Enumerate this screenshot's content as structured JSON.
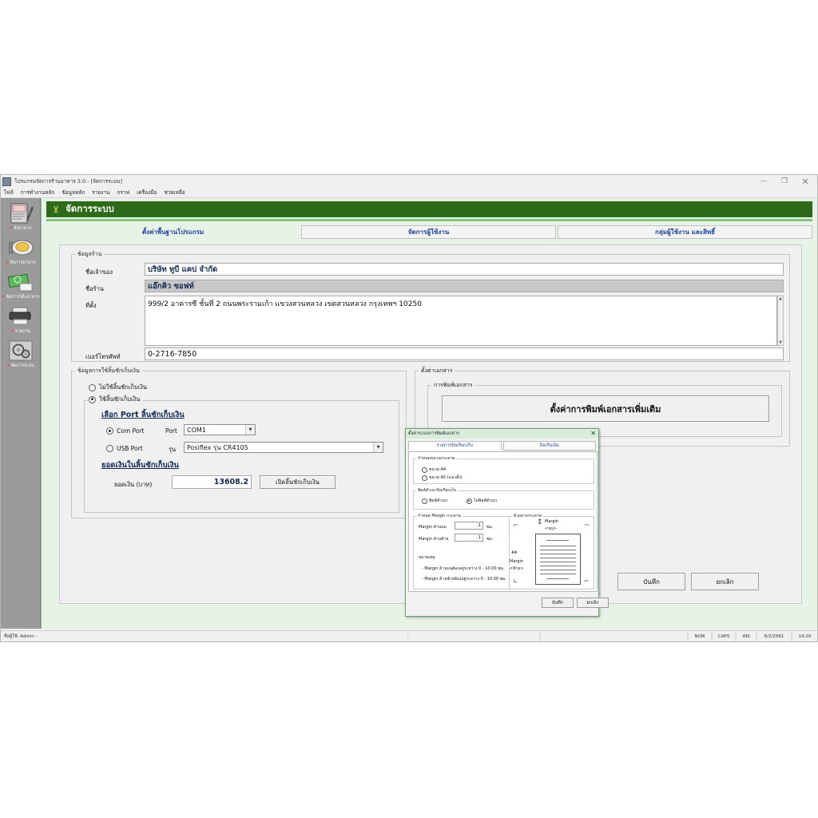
{
  "window": {
    "title": "โปรแกรมจัดการร้านอาหาร 3.0 - [จัดการระบบ]",
    "minimize": "—",
    "maximize": "❐",
    "close": "✕"
  },
  "menubar": {
    "items": [
      {
        "label": "ไฟล์"
      },
      {
        "label": "การทำงานหลัก"
      },
      {
        "label": "ข้อมูลหลัก"
      },
      {
        "label": "รายงาน"
      },
      {
        "label": "กราฟ"
      },
      {
        "label": "เครื่องมือ"
      },
      {
        "label": "ช่วยเหลือ"
      }
    ]
  },
  "sidebar": {
    "items": [
      {
        "label": "สั่งอาหาร",
        "icon": "order-notepad-icon"
      },
      {
        "label": "จัดการอาหาร",
        "icon": "food-plate-icon"
      },
      {
        "label": "จัดการโต๊ะอาหาร",
        "icon": "money-icon"
      },
      {
        "label": "รายงาน",
        "icon": "printer-icon"
      },
      {
        "label": "จัดการระบบ",
        "icon": "gears-icon"
      }
    ]
  },
  "header": {
    "icon": "funnel-icon",
    "title": "จัดการระบบ"
  },
  "tabs": [
    {
      "label": "ตั้งค่าพื้นฐานโปรแกรม",
      "active": true
    },
    {
      "label": "จัดการผู้ใช้งาน",
      "active": false
    },
    {
      "label": "กลุ่มผู้ใช้งาน และสิทธิ์",
      "active": false
    }
  ],
  "shop_info": {
    "legend": "ข้อมูลร้าน",
    "owner_label": "ชื่อเจ้าของ",
    "owner_value": "บริษัท ทูบี แคป จำกัด",
    "shop_label": "ชื่อร้าน",
    "shop_value": "แอ๊กคิว ซอฟท์",
    "address_label": "ที่ตั้ง",
    "address_value": "999/2 อาคารซี ชั้นที่ 2 ถนนพระรามเก้า แขวงสวนหลวง เขตสวนหลวง กรุงเทพฯ 10250",
    "phone_label": "เบอร์โทรศัพท์",
    "phone_value": "0-2716-7850"
  },
  "drawer": {
    "legend": "ข้อมูลการใช้ลิ้นชักเก็บเงิน",
    "opt_no": "ไม่ใช้ลิ้นชักเก็บเงิน",
    "opt_yes": "ใช้ลิ้นชักเก็บเงิน",
    "port_heading": "เลือก Port ลิ้นชักเก็บเงิน",
    "com_port_label": "Com Port",
    "port_label": "Port",
    "port_value": "COM1",
    "usb_port_label": "USB Port",
    "model_label": "รุ่น",
    "model_value": "Posiflex รุ่น CR4105",
    "amount_heading": "ยอดเงินในลิ้นชักเก็บเงิน",
    "amount_label": "ยอดเงิน (บาท)",
    "amount_value": "13608.2",
    "open_drawer_button": "เปิดลิ้นชักเก็บเงิน"
  },
  "doc_settings": {
    "legend": "ตั้งค่าเอกสาร",
    "print_legend": "การพิมพ์เอกสาร",
    "more_settings_button": "ตั้งค่าการพิมพ์เอกสารเพิ่มเติม"
  },
  "footer": {
    "save": "บันทึก",
    "cancel": "ยกเลิก"
  },
  "dialog": {
    "title": "ตั้งค่าระบบการพิมพ์เอกสาร",
    "close": "✕",
    "tabs": [
      {
        "label": "รายการบิลเรียกเก็บ",
        "active": true
      },
      {
        "label": "บิลเก็บเงิน",
        "active": false
      }
    ],
    "paper": {
      "legend": "กำหนดขนาดกระดาษ",
      "a4": "ขนาด A4",
      "a5": "ขนาด A5 (แนวตั้ง)"
    },
    "copy": {
      "legend": "พิมพ์สำเนาบิลเรียกเก็บ",
      "yes": "พิมพ์สำเนา",
      "no": "ไม่พิมพ์สำเนา"
    },
    "margin": {
      "legend": "กำหนด Margin กระดาษ",
      "top_label": "Margin ด้านบน",
      "top_value": ".1",
      "top_unit": "ซม.",
      "left_label": "Margin ด้านซ้าย",
      "left_value": ".1",
      "left_unit": "ซม.",
      "note_title": "หมายเหตุ",
      "note1": "- Margin ด้านบนต้องอยู่ระหว่าง 0 - 10.00 ซม.",
      "note2": "- Margin ด้านซ้ายต้องอยู่ระหว่าง 0 - 10.00 ซม."
    },
    "preview": {
      "legend": "ตัวอย่างกระดาษ",
      "top_label": "Margin",
      "top_sub": "<บน>",
      "left_label": "Margin",
      "left_sub": "<ซ้าย>"
    },
    "save": "บันทึก",
    "cancel": "ยกเลิก"
  },
  "statusbar": {
    "user": "ชื่อผู้ใช้: Admin -",
    "num": "NUM",
    "caps": "CAPS",
    "ins": "INS",
    "date": "6/2/2561",
    "time": "14:20"
  },
  "colors": {
    "header_green": "#2d6b18",
    "accent_green": "#7fc47f",
    "content_bg": "#e8f3e8",
    "tab_text": "#1a3fa0",
    "value_text": "#102a54"
  }
}
